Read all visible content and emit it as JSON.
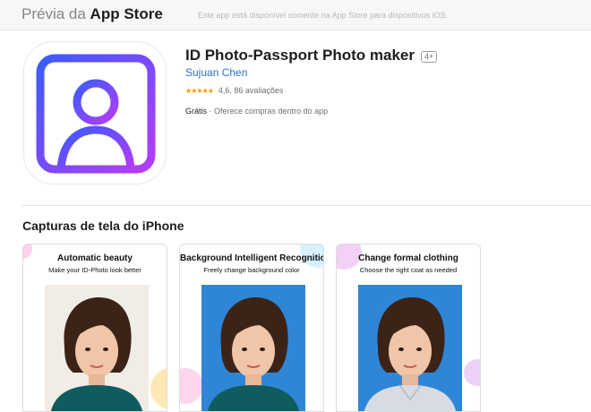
{
  "header": {
    "brand_light": "Prévia da ",
    "brand_bold": "App Store",
    "notice": "Este app está disponível somente na App Store para dispositivos iOS."
  },
  "app": {
    "title": "ID Photo-Passport Photo maker",
    "age_rating": "4+",
    "developer": "Sujuan Chen",
    "stars": "★★★★★",
    "rating_text": "4,6, 86 avaliações",
    "price": "Grátis",
    "purchases": "· Oferece compras dentro do app",
    "icon": "user-portrait-icon",
    "icon_colors": [
      "#3b5bff",
      "#b43cf5"
    ]
  },
  "screenshots": {
    "section_title": "Capturas de tela do iPhone",
    "items": [
      {
        "title": "Automatic beauty",
        "subtitle": "Make your ID-Photo look better",
        "background": "#f1ede6"
      },
      {
        "title": "Background Intelligent Recognition",
        "subtitle": "Freely change background color",
        "background": "#2f86d6"
      },
      {
        "title": "Change formal clothing",
        "subtitle": "Choose the right coat as needed",
        "background": "#2f86d6"
      }
    ]
  }
}
